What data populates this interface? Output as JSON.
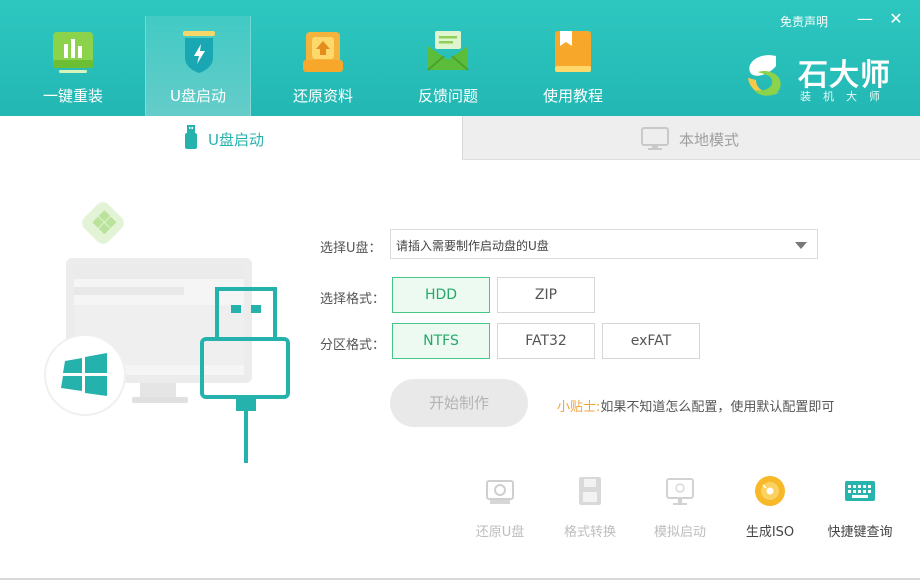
{
  "header": {
    "disclaimer": "免责声明",
    "minimize": "—",
    "close": "✕",
    "nav": [
      {
        "label": "一键重装",
        "icon": "bar-chart-icon"
      },
      {
        "label": "U盘启动",
        "icon": "usb-shield-icon"
      },
      {
        "label": "还原资料",
        "icon": "restore-folder-icon"
      },
      {
        "label": "反馈问题",
        "icon": "feedback-mail-icon"
      },
      {
        "label": "使用教程",
        "icon": "tutorial-book-icon"
      }
    ],
    "active_nav": "U盘启动",
    "brand": {
      "title": "石大师",
      "subtitle": "装机大师"
    },
    "colors": {
      "header": "#2ec7c0",
      "accent": "#25b2ad"
    }
  },
  "tabs": [
    {
      "label": "U盘启动",
      "active": true
    },
    {
      "label": "本地模式",
      "active": false
    }
  ],
  "form": {
    "usb_label": "选择U盘：",
    "usb_value": "请插入需要制作启动盘的U盘",
    "format_label": "选择格式：",
    "formats": [
      "HDD",
      "ZIP"
    ],
    "selected_format": "HDD",
    "partition_label": "分区格式：",
    "partitions": [
      "NTFS",
      "FAT32",
      "exFAT"
    ],
    "selected_partition": "NTFS",
    "start_button": "开始制作",
    "tip_key": "小贴士:",
    "tip_text": "如果不知道怎么配置，使用默认配置即可"
  },
  "tools": [
    {
      "label": "还原U盘",
      "icon": "restore-usb-icon",
      "enabled": false
    },
    {
      "label": "格式转换",
      "icon": "floppy-icon",
      "enabled": false
    },
    {
      "label": "模拟启动",
      "icon": "monitor-icon",
      "enabled": false
    },
    {
      "label": "生成ISO",
      "icon": "disc-icon",
      "enabled": true
    },
    {
      "label": "快捷键查询",
      "icon": "keyboard-icon",
      "enabled": true
    }
  ]
}
